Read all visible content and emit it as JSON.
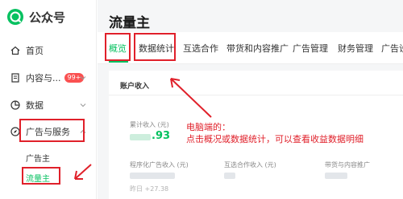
{
  "app": {
    "logo_text": "公众号",
    "page_title": "流量主",
    "brand_color": "#07c160",
    "annotation_color": "#e0202a"
  },
  "sidebar": {
    "items": [
      {
        "label": "首页",
        "icon": "home-icon"
      },
      {
        "label": "内容与...",
        "icon": "document-icon",
        "badge": "99+"
      },
      {
        "label": "数据",
        "icon": "chart-icon"
      },
      {
        "label": "广告与服务",
        "icon": "compass-icon"
      }
    ],
    "sub_items": [
      {
        "label": "广告主"
      },
      {
        "label": "流量主"
      }
    ]
  },
  "tabs": [
    {
      "label": "概览"
    },
    {
      "label": "数据统计"
    },
    {
      "label": "互选合作"
    },
    {
      "label": "带货和内容推广"
    },
    {
      "label": "广告管理"
    },
    {
      "label": "财务管理"
    },
    {
      "label": "广告设"
    }
  ],
  "account": {
    "title": "账户收入",
    "total_label": "累计收入 (元)",
    "total_value_suffix": ".93",
    "program_label": "程序化广告收入 (元)",
    "program_note": "昨日 +27.38",
    "mutual_label": "互选合作收入 (元)",
    "goods_label": "带货与内容推广"
  },
  "annotation": {
    "line1": "电脑端的：",
    "line2": "点击概况或数据统计，可以查看收益数据明细"
  }
}
